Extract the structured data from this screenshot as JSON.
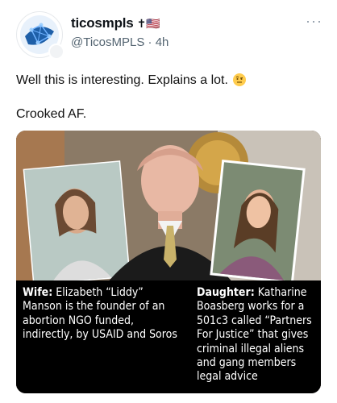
{
  "post": {
    "display_name": "ticosmpls",
    "name_emoji": "✝🇺🇸",
    "handle": "@TicosMPLS",
    "separator": "·",
    "time": "4h",
    "more_label": "···",
    "text_line1": "Well this is interesting. Explains a lot.",
    "text_line2": "Crooked AF."
  },
  "image": {
    "caption_left_label": "Wife:",
    "caption_left_text": "Elizabeth “Liddy” Manson is the founder of an abortion NGO funded, indirectly, by USAID and Soros",
    "caption_right_label": "Daughter:",
    "caption_right_text": "Katharine Boasberg works for a 501c3 called “Partners For Justice” that gives criminal illegal aliens and gang members legal advice"
  },
  "icons": {
    "avatar": "globe-network-icon",
    "emoji": "raised-eyebrow-face-icon",
    "more": "more-dots-icon"
  },
  "colors": {
    "text": "#0f1419",
    "muted": "#536471",
    "caption_bg": "#000000"
  }
}
